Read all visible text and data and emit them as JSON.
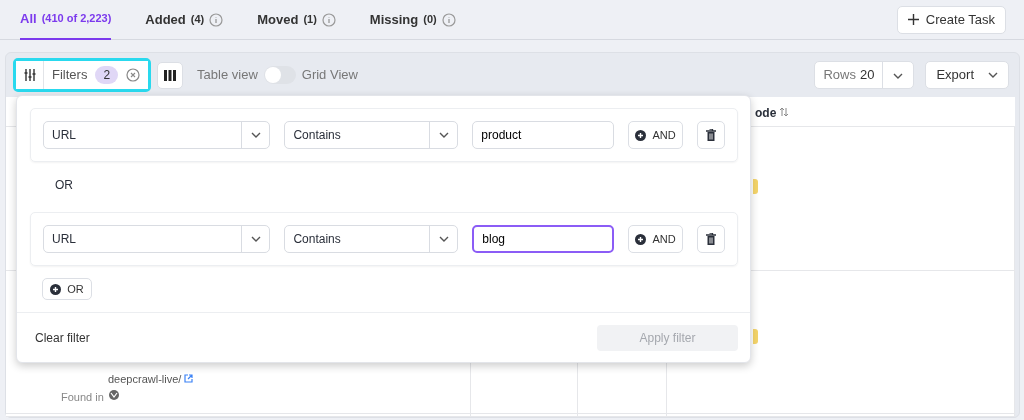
{
  "tabs": [
    {
      "label": "All",
      "count": "(410 of 2,223)",
      "selected": true,
      "info": false
    },
    {
      "label": "Added",
      "count": "(4)",
      "selected": false,
      "info": true
    },
    {
      "label": "Moved",
      "count": "(1)",
      "selected": false,
      "info": true
    },
    {
      "label": "Missing",
      "count": "(0)",
      "selected": false,
      "info": true
    }
  ],
  "create_task_button": "Create Task",
  "toolbar": {
    "filters": {
      "label": "Filters",
      "count": "2",
      "highlighted": true
    },
    "view_toggle": {
      "left_label": "Table view",
      "right_label": "Grid View",
      "on": false
    },
    "rows": {
      "label": "Rows",
      "value": "20"
    },
    "export": "Export"
  },
  "table": {
    "column_3": {
      "label": "ode",
      "sortable": true
    },
    "row_2": {
      "url_continued": "deepcrawl-live/",
      "found_in_label": "Found in"
    }
  },
  "filter_panel": {
    "filters": [
      {
        "field": "URL",
        "operator": "Contains",
        "value": "product",
        "focused": false,
        "and_label": "AND"
      },
      {
        "field": "URL",
        "operator": "Contains",
        "value": "blog",
        "focused": true,
        "and_label": "AND"
      }
    ],
    "separator": "OR",
    "add_or_label": "OR",
    "clear_label": "Clear filter",
    "apply": {
      "label": "Apply filter",
      "disabled": true
    }
  }
}
